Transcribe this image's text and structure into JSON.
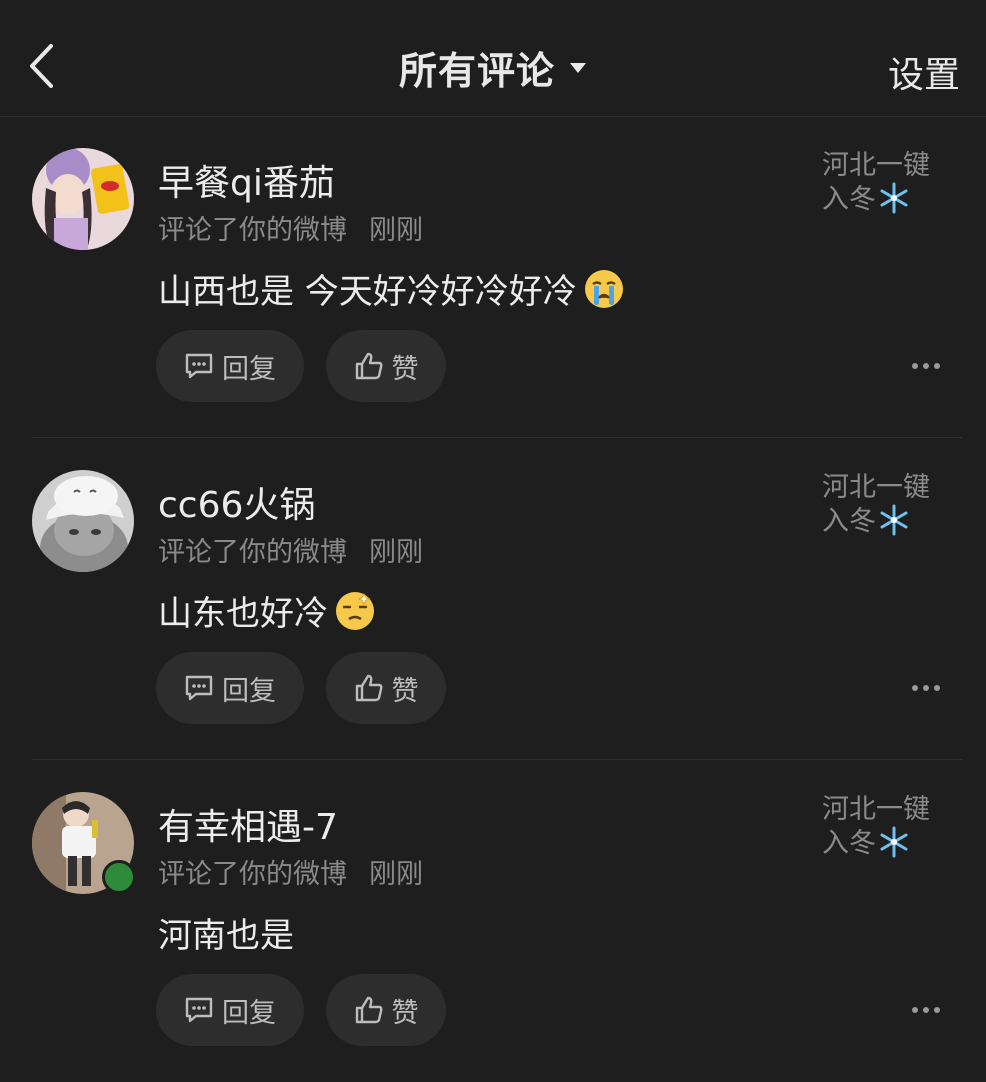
{
  "header": {
    "title": "所有评论",
    "settings_label": "设置"
  },
  "comments": [
    {
      "username": "早餐qi番茄",
      "action": "评论了你的微博",
      "time": "刚刚",
      "post_ref": "河北一键入冬",
      "text": "山西也是 今天好冷好冷好冷",
      "emoji": "crying-face",
      "reply_label": "回复",
      "like_label": "赞"
    },
    {
      "username": "cc66火锅",
      "action": "评论了你的微博",
      "time": "刚刚",
      "post_ref": "河北一键入冬",
      "text": "山东也好冷",
      "emoji": "dizzy-face",
      "reply_label": "回复",
      "like_label": "赞"
    },
    {
      "username": "有幸相遇-7",
      "action": "评论了你的微博",
      "time": "刚刚",
      "post_ref": "河北一键入冬",
      "text": "河南也是",
      "emoji": "",
      "reply_label": "回复",
      "like_label": "赞"
    }
  ],
  "colors": {
    "background": "#1e1e1e",
    "pill": "#2d2d2d",
    "muted_text": "#8a8a8a",
    "online": "#2e8b3a",
    "snowflake": "#6ec1ee"
  }
}
